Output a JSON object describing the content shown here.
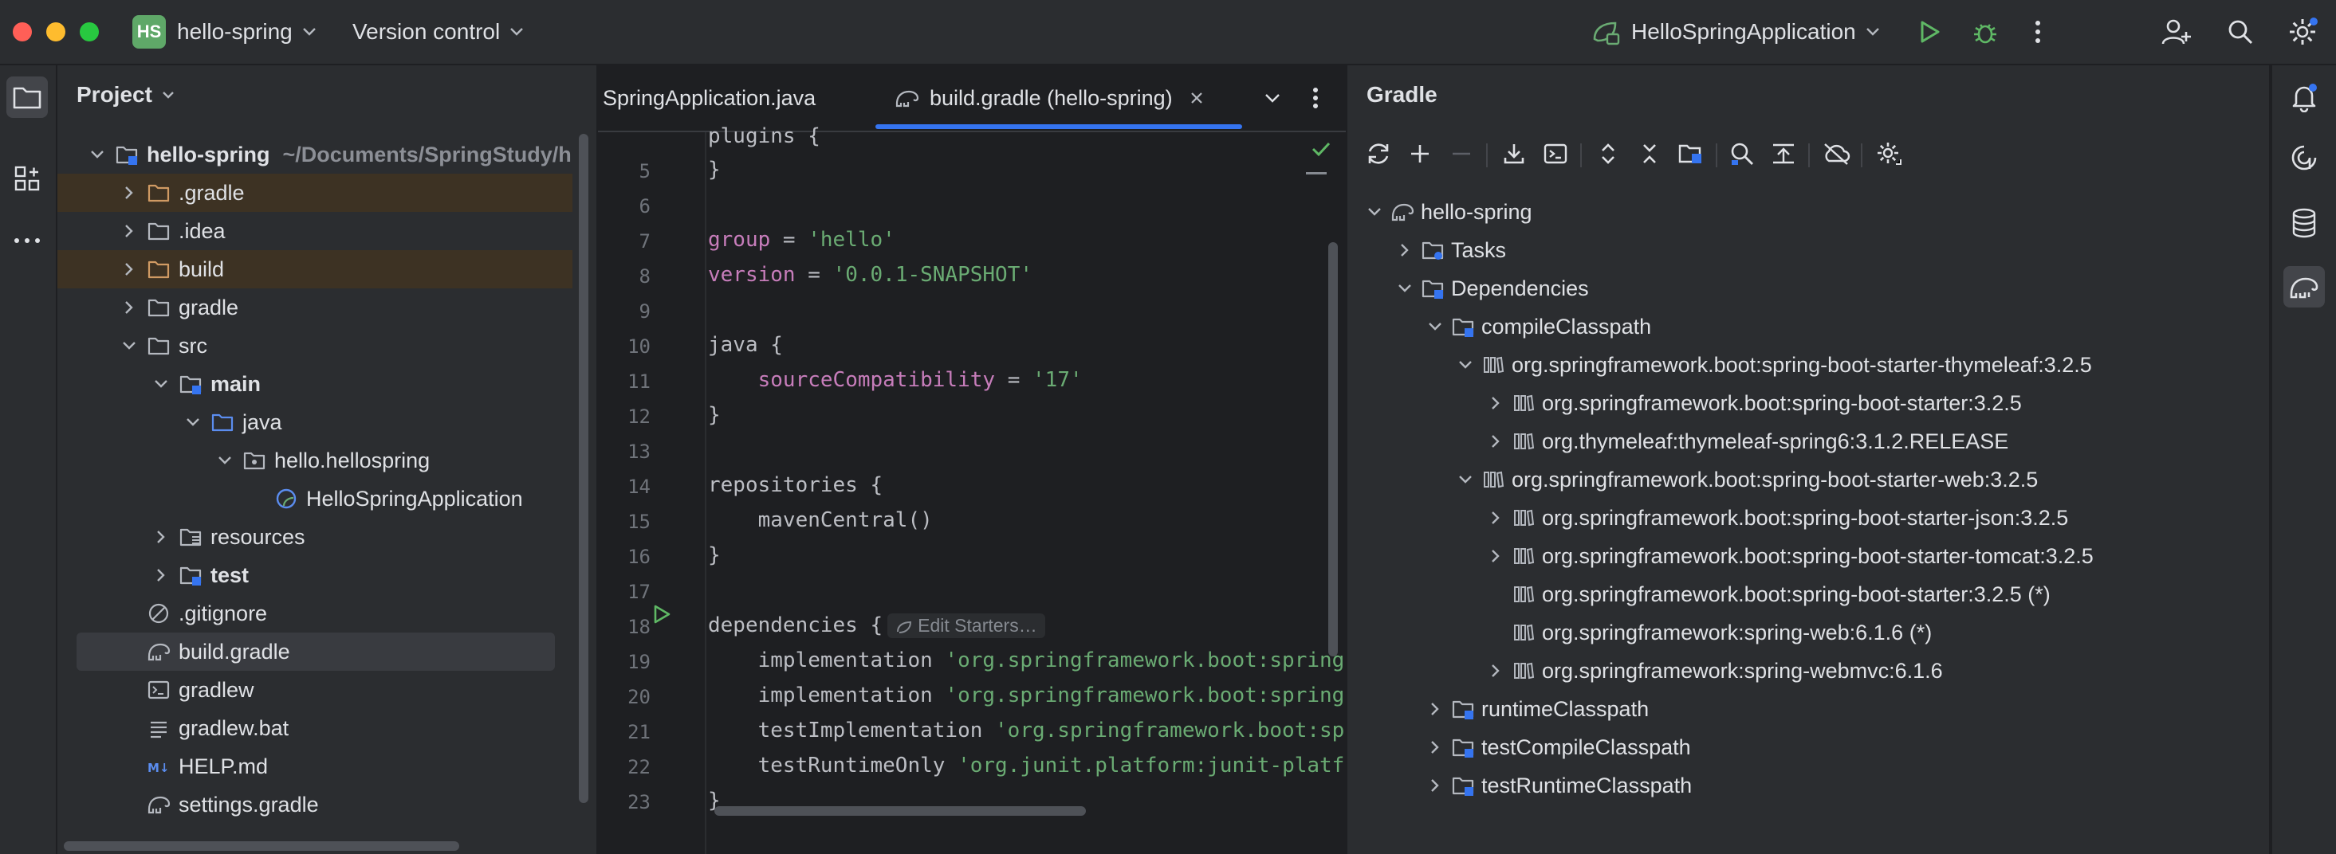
{
  "titlebar": {
    "project_badge": "HS",
    "project_name": "hello-spring",
    "vcs_label": "Version control",
    "run_config": "HelloSpringApplication"
  },
  "project_panel": {
    "title": "Project",
    "tree": [
      {
        "label": "hello-spring",
        "suffix": "~/Documents/SpringStudy/h",
        "depth": 0,
        "expand": "open",
        "icon": "module-folder-icon",
        "bold": true
      },
      {
        "label": ".gradle",
        "depth": 1,
        "expand": "closed",
        "icon": "folder-orange-icon",
        "highlight": "excluded"
      },
      {
        "label": ".idea",
        "depth": 1,
        "expand": "closed",
        "icon": "folder-icon"
      },
      {
        "label": "build",
        "depth": 1,
        "expand": "closed",
        "icon": "folder-orange-icon",
        "highlight": "excluded"
      },
      {
        "label": "gradle",
        "depth": 1,
        "expand": "closed",
        "icon": "folder-icon"
      },
      {
        "label": "src",
        "depth": 1,
        "expand": "open",
        "icon": "folder-icon"
      },
      {
        "label": "main",
        "depth": 2,
        "expand": "open",
        "icon": "module-folder-icon",
        "bold": true
      },
      {
        "label": "java",
        "depth": 3,
        "expand": "open",
        "icon": "folder-blue-icon"
      },
      {
        "label": "hello.hellospring",
        "depth": 4,
        "expand": "open",
        "icon": "package-icon"
      },
      {
        "label": "HelloSpringApplication",
        "depth": 5,
        "expand": "none",
        "icon": "spring-class-icon"
      },
      {
        "label": "resources",
        "depth": 2,
        "expand": "closed",
        "icon": "resources-folder-icon"
      },
      {
        "label": "test",
        "depth": 2,
        "expand": "closed",
        "icon": "module-folder-icon",
        "bold": true
      },
      {
        "label": ".gitignore",
        "depth": 1,
        "expand": "none",
        "icon": "ignore-icon"
      },
      {
        "label": "build.gradle",
        "depth": 1,
        "expand": "none",
        "icon": "gradle-icon",
        "highlight": "selected"
      },
      {
        "label": "gradlew",
        "depth": 1,
        "expand": "none",
        "icon": "terminal-icon"
      },
      {
        "label": "gradlew.bat",
        "depth": 1,
        "expand": "none",
        "icon": "text-file-icon"
      },
      {
        "label": "HELP.md",
        "depth": 1,
        "expand": "none",
        "icon": "markdown-icon"
      },
      {
        "label": "settings.gradle",
        "depth": 1,
        "expand": "none",
        "icon": "gradle-icon"
      }
    ]
  },
  "editor": {
    "tabs": [
      {
        "label": "SpringApplication.java",
        "active": false
      },
      {
        "label": "build.gradle (hello-spring)",
        "active": true
      }
    ],
    "partial_top": "plugins {",
    "lines": [
      {
        "num": "5",
        "parts": [
          {
            "t": "}",
            "c": ""
          }
        ]
      },
      {
        "num": "6",
        "parts": []
      },
      {
        "num": "7",
        "parts": [
          {
            "t": "group",
            "c": "purple"
          },
          {
            "t": " = ",
            "c": ""
          },
          {
            "t": "'hello'",
            "c": "green"
          }
        ]
      },
      {
        "num": "8",
        "parts": [
          {
            "t": "version",
            "c": "purple"
          },
          {
            "t": " = ",
            "c": ""
          },
          {
            "t": "'0.0.1-SNAPSHOT'",
            "c": "green"
          }
        ]
      },
      {
        "num": "9",
        "parts": []
      },
      {
        "num": "10",
        "parts": [
          {
            "t": "java {",
            "c": ""
          }
        ]
      },
      {
        "num": "11",
        "parts": [
          {
            "t": "    ",
            "c": ""
          },
          {
            "t": "sourceCompatibility",
            "c": "purple"
          },
          {
            "t": " = ",
            "c": ""
          },
          {
            "t": "'17'",
            "c": "green"
          }
        ]
      },
      {
        "num": "12",
        "parts": [
          {
            "t": "}",
            "c": ""
          }
        ]
      },
      {
        "num": "13",
        "parts": []
      },
      {
        "num": "14",
        "parts": [
          {
            "t": "repositories {",
            "c": ""
          }
        ]
      },
      {
        "num": "15",
        "parts": [
          {
            "t": "    mavenCentral()",
            "c": ""
          }
        ]
      },
      {
        "num": "16",
        "parts": [
          {
            "t": "}",
            "c": ""
          }
        ]
      },
      {
        "num": "17",
        "parts": []
      },
      {
        "num": "18",
        "parts": [
          {
            "t": "dependencies {",
            "c": ""
          }
        ],
        "inlay": "Edit Starters…"
      },
      {
        "num": "19",
        "parts": [
          {
            "t": "    implementation ",
            "c": ""
          },
          {
            "t": "'org.springframework.boot:spring-",
            "c": "green"
          }
        ]
      },
      {
        "num": "20",
        "parts": [
          {
            "t": "    implementation ",
            "c": ""
          },
          {
            "t": "'org.springframework.boot:spring-",
            "c": "green"
          }
        ]
      },
      {
        "num": "21",
        "parts": [
          {
            "t": "    testImplementation ",
            "c": ""
          },
          {
            "t": "'org.springframework.boot:spr",
            "c": "green"
          }
        ]
      },
      {
        "num": "22",
        "parts": [
          {
            "t": "    testRuntimeOnly ",
            "c": ""
          },
          {
            "t": "'org.junit.platform:junit-platfo",
            "c": "green"
          }
        ]
      },
      {
        "num": "23",
        "parts": [
          {
            "t": "}",
            "c": ""
          }
        ]
      }
    ]
  },
  "gradle_panel": {
    "title": "Gradle",
    "toolbar": [
      "reload-icon",
      "plus-icon",
      "minus-icon",
      "download-icon",
      "execute-task-icon",
      "expand-all-icon",
      "collapse-all-icon",
      "dependency-analyzer-icon",
      "analyze-icon",
      "toggle-offline-icon",
      "offline-cloud-icon",
      "settings-icon"
    ],
    "tree": [
      {
        "label": "hello-spring",
        "depth": 0,
        "expand": "open",
        "icon": "gradle-elephant-icon"
      },
      {
        "label": "Tasks",
        "depth": 1,
        "expand": "closed",
        "icon": "tasks-folder-icon"
      },
      {
        "label": "Dependencies",
        "depth": 1,
        "expand": "open",
        "icon": "dependencies-folder-icon"
      },
      {
        "label": "compileClasspath",
        "depth": 2,
        "expand": "open",
        "icon": "classpath-icon"
      },
      {
        "label": "org.springframework.boot:spring-boot-starter-thymeleaf:3.2.5",
        "depth": 3,
        "expand": "open",
        "icon": "library-icon"
      },
      {
        "label": "org.springframework.boot:spring-boot-starter:3.2.5",
        "depth": 4,
        "expand": "closed",
        "icon": "library-icon"
      },
      {
        "label": "org.thymeleaf:thymeleaf-spring6:3.1.2.RELEASE",
        "depth": 4,
        "expand": "closed",
        "icon": "library-icon"
      },
      {
        "label": "org.springframework.boot:spring-boot-starter-web:3.2.5",
        "depth": 3,
        "expand": "open",
        "icon": "library-icon"
      },
      {
        "label": "org.springframework.boot:spring-boot-starter-json:3.2.5",
        "depth": 4,
        "expand": "closed",
        "icon": "library-icon"
      },
      {
        "label": "org.springframework.boot:spring-boot-starter-tomcat:3.2.5",
        "depth": 4,
        "expand": "closed",
        "icon": "library-icon"
      },
      {
        "label": "org.springframework.boot:spring-boot-starter:3.2.5 (*)",
        "depth": 4,
        "expand": "none",
        "icon": "library-icon"
      },
      {
        "label": "org.springframework:spring-web:6.1.6 (*)",
        "depth": 4,
        "expand": "none",
        "icon": "library-icon"
      },
      {
        "label": "org.springframework:spring-webmvc:6.1.6",
        "depth": 4,
        "expand": "closed",
        "icon": "library-icon"
      },
      {
        "label": "runtimeClasspath",
        "depth": 2,
        "expand": "closed",
        "icon": "classpath-icon"
      },
      {
        "label": "testCompileClasspath",
        "depth": 2,
        "expand": "closed",
        "icon": "classpath-icon"
      },
      {
        "label": "testRuntimeClasspath",
        "depth": 2,
        "expand": "closed",
        "icon": "classpath-icon"
      }
    ]
  },
  "colors": {
    "background": "#1e1f22",
    "panel": "#2b2d30",
    "accent": "#3574f0",
    "excluded_row": "#3d3223",
    "selected_row": "#393b40",
    "run_green": "#5fb865",
    "string_green": "#6aab73",
    "keyword_purple": "#c77dbb"
  }
}
